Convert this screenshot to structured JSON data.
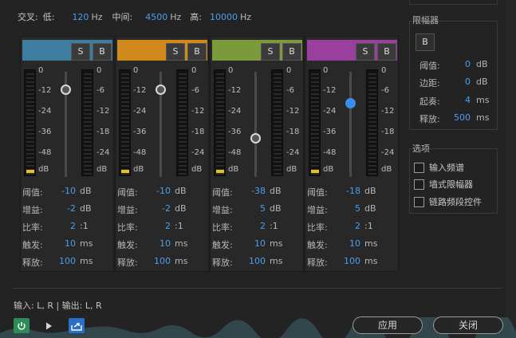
{
  "crossover": {
    "label": "交叉:",
    "low_label": "低:",
    "low_value": "120",
    "low_unit": "Hz",
    "mid_label": "中间:",
    "mid_value": "4500",
    "mid_unit": "Hz",
    "high_label": "高:",
    "high_value": "10000",
    "high_unit": "Hz"
  },
  "band_colors": [
    "#3c7da0",
    "#d08a1c",
    "#7a9a3c",
    "#9a3f9e"
  ],
  "solo_label": "S",
  "bypass_label": "B",
  "scale_left": [
    "0",
    "-12",
    "-24",
    "-36",
    "-48",
    "dB"
  ],
  "scale_right": [
    "0",
    "-6",
    "-12",
    "-18",
    "-24",
    "dB"
  ],
  "param_labels": [
    "阈值:",
    "增益:",
    "比率:",
    "触发:",
    "释放:"
  ],
  "bands": [
    {
      "threshold": "-10",
      "threshold_unit": "dB",
      "gain": "-2",
      "gain_unit": "dB",
      "ratio": "2",
      "ratio_unit": ":1",
      "attack": "10",
      "attack_unit": "ms",
      "release": "100",
      "release_unit": "ms",
      "knob_pos": 0.17,
      "active": false
    },
    {
      "threshold": "-10",
      "threshold_unit": "dB",
      "gain": "-2",
      "gain_unit": "dB",
      "ratio": "2",
      "ratio_unit": ":1",
      "attack": "10",
      "attack_unit": "ms",
      "release": "100",
      "release_unit": "ms",
      "knob_pos": 0.17,
      "active": false
    },
    {
      "threshold": "-38",
      "threshold_unit": "dB",
      "gain": "5",
      "gain_unit": "dB",
      "ratio": "2",
      "ratio_unit": ":1",
      "attack": "10",
      "attack_unit": "ms",
      "release": "100",
      "release_unit": "ms",
      "knob_pos": 0.63,
      "active": false
    },
    {
      "threshold": "-18",
      "threshold_unit": "dB",
      "gain": "5",
      "gain_unit": "dB",
      "ratio": "2",
      "ratio_unit": ":1",
      "attack": "10",
      "attack_unit": "ms",
      "release": "100",
      "release_unit": "ms",
      "knob_pos": 0.3,
      "active": true
    }
  ],
  "limiter": {
    "title": "限幅器",
    "bypass_label": "B",
    "threshold_label": "阈值:",
    "threshold": "0",
    "threshold_unit": "dB",
    "margin_label": "边距:",
    "margin": "0",
    "margin_unit": "dB",
    "attack_label": "起奏:",
    "attack": "4",
    "attack_unit": "ms",
    "release_label": "释放:",
    "release": "500",
    "release_unit": "ms"
  },
  "options": {
    "title": "选项",
    "items": [
      "输入频谱",
      "墙式限幅器",
      "链路频段控件"
    ]
  },
  "io_text": "输入: L, R | 输出: L, R",
  "apply_label": "应用",
  "close_label": "关闭",
  "icons": {
    "power": "power-icon",
    "play": "play-icon",
    "export": "export-icon"
  },
  "accent_color": "#4a9ff0"
}
